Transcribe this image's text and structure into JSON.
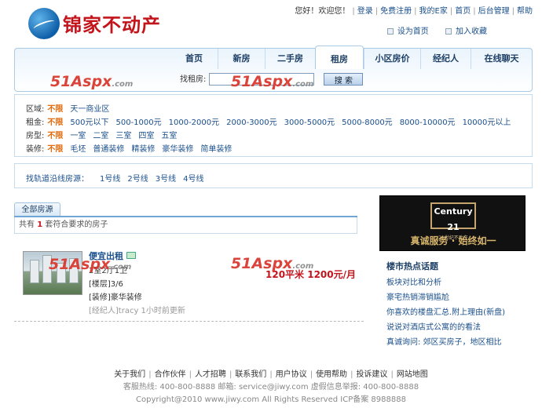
{
  "logo": {
    "text": "锦家不动产"
  },
  "topnav": {
    "greeting": "您好！欢迎您！",
    "links": [
      "登录",
      "免费注册",
      "我的E家",
      "首页",
      "后台管理",
      "帮助"
    ]
  },
  "sublinks": {
    "homepage": "设为首页",
    "favorite": "加入收藏"
  },
  "nav": {
    "tabs": [
      "首页",
      "新房",
      "二手房",
      "租房",
      "小区房价",
      "经纪人",
      "在线聊天"
    ],
    "active": "租房",
    "search_label": "找租房:",
    "search_value": "",
    "search_button": "搜 索"
  },
  "watermark": {
    "text": "51Aspx",
    "suffix": ".com"
  },
  "filters": {
    "region": {
      "label": "区域:",
      "selected": "不限",
      "options": [
        "天一商业区"
      ]
    },
    "rent": {
      "label": "租金:",
      "selected": "不限",
      "options": [
        "500元以下",
        "500-1000元",
        "1000-2000元",
        "2000-3000元",
        "3000-5000元",
        "5000-8000元",
        "8000-10000元",
        "10000元以上"
      ]
    },
    "type": {
      "label": "房型:",
      "selected": "不限",
      "options": [
        "一室",
        "二室",
        "三室",
        "四室",
        "五室"
      ]
    },
    "decor": {
      "label": "装修:",
      "selected": "不限",
      "options": [
        "毛坯",
        "普通装修",
        "精装修",
        "豪华装修",
        "简单装修"
      ]
    }
  },
  "metro": {
    "label": "找轨道沿线房源：",
    "lines": [
      "1号线",
      "2号线",
      "3号线",
      "4号线"
    ]
  },
  "listing": {
    "tab": "全部房源",
    "count_prefix": "共有",
    "count": "1",
    "count_suffix": "套符合要求的房子",
    "item": {
      "title": "便宜出租",
      "layout": "2室2厅1卫",
      "floor": "[楼层]3/6",
      "decor": "[装修]豪华装修",
      "agent": "[经纪人]tracy 1小时前更新",
      "price": "120平米 1200元/月"
    }
  },
  "ad": {
    "brand": "Century 21",
    "brand_sub": "21世纪不动产",
    "slogan": "真诚服务 · 始终如一"
  },
  "hot": {
    "title": "楼市热点话题",
    "items": [
      "板块对比和分析",
      "豪宅热销滞销尴尬",
      "你喜欢的楼盘汇总.附上理由(新盘)",
      "说说对酒店式公寓的的看法",
      "真诚询问: 郊区买房子，地区相比"
    ]
  },
  "footer": {
    "links": [
      "关于我们",
      "合作伙伴",
      "人才招聘",
      "联系我们",
      "用户协议",
      "使用帮助",
      "投诉建议",
      "网站地图"
    ],
    "contact": "客服热线: 400-800-8888 邮箱: service@jiwy.com 虚假信息举报: 400-800-8888",
    "copyright": "Copyright@2010 www.jiwy.com All Rights Reserved ICP备案 8988888"
  }
}
